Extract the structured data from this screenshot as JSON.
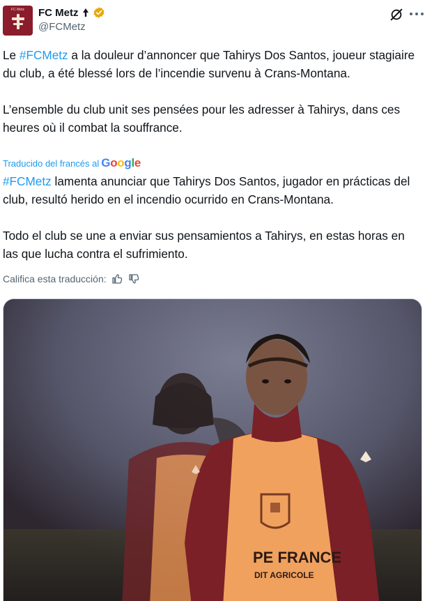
{
  "author": {
    "display_name": "FC Metz",
    "handle": "@FCMetz",
    "avatar_text": "FC Metz",
    "badge_color": "#e8a70c"
  },
  "tweet": {
    "paragraphs": [
      {
        "hashtag_prefix": "Le ",
        "hashtag": "#FCMetz",
        "text": " a la douleur d’annoncer que Tahirys Dos Santos, joueur stagiaire du club, a été blessé lors de l’incendie survenu à Crans-Montana."
      },
      {
        "text": "L’ensemble du club unit ses pensées pour les adresser à Tahirys, dans ces heures où il combat la souffrance."
      }
    ]
  },
  "translation": {
    "label": "Traducido del francés al",
    "provider": "Google",
    "paragraphs": [
      {
        "hashtag": "#FCMetz",
        "text": " lamenta anunciar que Tahirys Dos Santos, jugador en prácticas del club, resultó herido en el incendio ocurrido en Crans-Montana."
      },
      {
        "text": "Todo el club se une a enviar sus pensamientos a Tahirys, en estas horas en las que lucha contra el sufrimiento."
      }
    ],
    "rate_label": "Califica esta traducción:"
  },
  "media": {
    "kit_brand": "Kappa",
    "bib_sponsor_line1": "PE FRANCE",
    "bib_sponsor_line2": "DIT AGRICOLE"
  },
  "colors": {
    "accent": "#1d9bf0",
    "secondary_text": "#536471",
    "club_maroon": "#8a1c2b",
    "bib_orange": "#f0a15e"
  }
}
